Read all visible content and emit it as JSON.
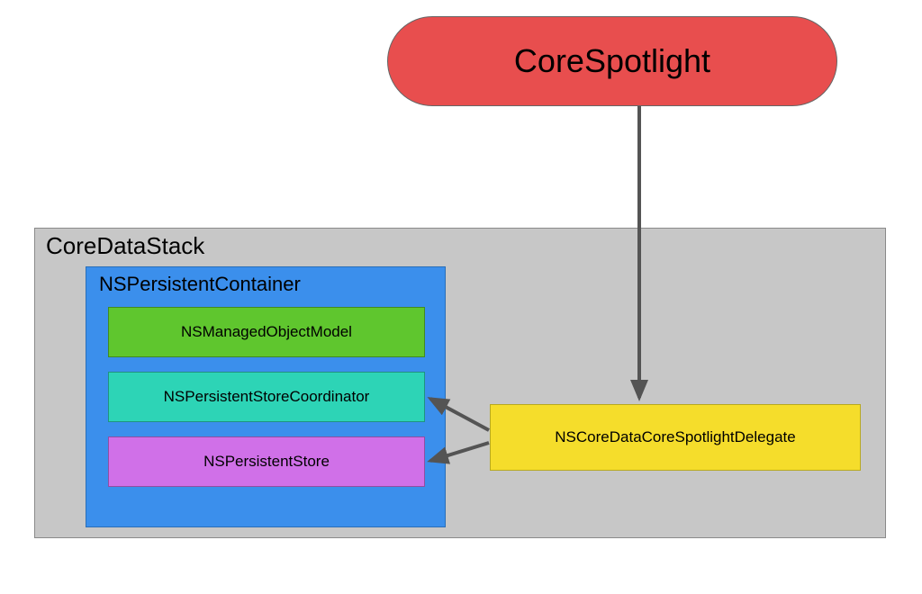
{
  "nodes": {
    "corespotlight": "CoreSpotlight",
    "core_data_stack": "CoreDataStack",
    "persistent_container": "NSPersistentContainer",
    "managed_object_model": "NSManagedObjectModel",
    "persistent_store_coordinator": "NSPersistentStoreCoordinator",
    "persistent_store": "NSPersistentStore",
    "delegate": "NSCoreDataCoreSpotlightDelegate"
  },
  "colors": {
    "corespotlight_bg": "#e84e4e",
    "stack_bg": "#c7c7c7",
    "container_bg": "#3b8fec",
    "model_bg": "#5fc62e",
    "coordinator_bg": "#2dd4b6",
    "store_bg": "#d070e8",
    "delegate_bg": "#f5dd2b",
    "arrow": "#545454"
  },
  "edges": [
    {
      "from": "corespotlight",
      "to": "delegate"
    },
    {
      "from": "delegate",
      "to": "persistent_store_coordinator"
    },
    {
      "from": "delegate",
      "to": "persistent_store"
    }
  ]
}
